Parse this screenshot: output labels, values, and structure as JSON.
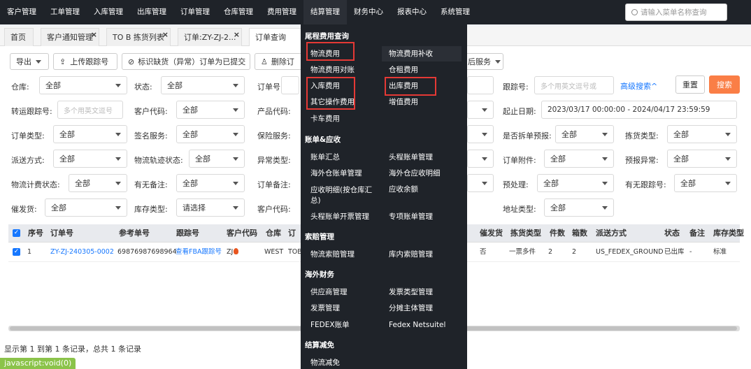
{
  "topnav": {
    "items": [
      "客户管理",
      "工单管理",
      "入库管理",
      "出库管理",
      "订单管理",
      "仓库管理",
      "费用管理",
      "结算管理",
      "财务中心",
      "报表中心",
      "系统管理"
    ],
    "search_placeholder": "请输入菜单名称查询"
  },
  "tabs": [
    "首页",
    "客户通知管理",
    "TO B 拣货列表",
    "订单:ZY-ZJ-2...",
    "订单查询"
  ],
  "toolbar": {
    "export": "导出",
    "upload_tracking": "上传跟踪号",
    "mark_abnormal": "标识缺货（异常）订单为已提交",
    "delete_prefix": "删除订",
    "after_sales": "后服务"
  },
  "filters": {
    "row1": {
      "warehouse_label": "仓库:",
      "warehouse_value": "全部",
      "status_label": "状态:",
      "status_value": "全部",
      "order_no_label": "订单号:",
      "tracking_label": "跟踪号:",
      "tracking_placeholder": "多个用英文逗号或",
      "advanced": "高级搜索^",
      "reset": "重置",
      "search": "搜索"
    },
    "row2": {
      "transfer_label": "转运跟踪号:",
      "transfer_placeholder": "多个用英文逗号",
      "customer_code_label": "客户代码:",
      "customer_code_value": "全部",
      "product_code_label": "产品代码:",
      "date_label": "起止日期:",
      "date_value": "2023/03/17 00:00:00 - 2024/04/17 23:59:59"
    },
    "row3": {
      "order_type_label": "订单类型:",
      "order_type_value": "全部",
      "sign_label": "签名服务:",
      "sign_value": "全部",
      "insure_label": "保险服务:",
      "split_label": "是否拆单预报:",
      "split_value": "全部",
      "pick_label": "拣货类型:",
      "pick_value": "全部"
    },
    "row4": {
      "dispatch_label": "派送方式:",
      "dispatch_value": "全部",
      "track_status_label": "物流轨迹状态:",
      "track_status_value": "全部",
      "abnormal_label": "异常类型:",
      "attach_label": "订单附件:",
      "attach_value": "全部",
      "forecast_label": "预报异常:",
      "forecast_value": "全部"
    },
    "row5": {
      "billing_label": "物流计费状态:",
      "billing_value": "全部",
      "remark_label": "有无备注:",
      "remark_value": "全部",
      "order_remark_label": "订单备注:",
      "preprocess_label": "预处理:",
      "preprocess_value": "全部",
      "notrack_label": "有无跟踪号:",
      "notrack_value": "全部"
    },
    "row6": {
      "urge_label": "催发货:",
      "urge_value": "全部",
      "stock_label": "库存类型:",
      "stock_value": "请选择",
      "cust_code_label": "客户代码:",
      "addr_label": "地址类型:",
      "addr_value": "全部"
    }
  },
  "table": {
    "headers": [
      "序号",
      "订单号",
      "参考单号",
      "跟踪号",
      "客户代码",
      "仓库",
      "订",
      "催发货",
      "拣货类型",
      "件数",
      "箱数",
      "派送方式",
      "状态",
      "备注",
      "库存类型"
    ],
    "row": {
      "seq": "1",
      "order_no": "ZY-ZJ-240305-0002",
      "ref_no": "69876987698964",
      "tracking": "查看FBA跟踪号",
      "customer": "ZJ",
      "warehouse": "WEST",
      "warehouse_cut": "TOB",
      "urge": "否",
      "pick_type": "一票多件",
      "pieces": "2",
      "boxes": "2",
      "dispatch": "US_FEDEX_GROUND",
      "status": "已出库",
      "remark": "-",
      "stock_type": "标准"
    }
  },
  "footer": {
    "records": "显示第 1 到第 1 条记录，总共 1 条记录",
    "status": "javascript:void(0)"
  },
  "dropdown": {
    "sec1": "尾程费用查询",
    "sec1_items": [
      "物流费用",
      "物流费用补收",
      "物流费用对账",
      "仓租费用",
      "入库费用",
      "出库费用",
      "其它操作费用",
      "增值费用",
      "卡车费用"
    ],
    "sec2": "账单&应收",
    "sec2_items": [
      "账单汇总",
      "头程账单管理",
      "海外仓账单管理",
      "海外仓应收明细",
      "应收明细(按仓库汇总)",
      "应收余额",
      "头程账单开票管理",
      "专项账单管理"
    ],
    "sec3": "索赔管理",
    "sec3_items": [
      "物流索赔管理",
      "库内索赔管理"
    ],
    "sec4": "海外财务",
    "sec4_items": [
      "供应商管理",
      "发票类型管理",
      "发票管理",
      "分摊主体管理",
      "FEDEX账单",
      "Fedex Netsuitel"
    ],
    "sec5": "结算减免",
    "sec5_items": [
      "物流减免"
    ]
  },
  "colors": {
    "nav_bg": "#1f2329",
    "accent_blue": "#1677ff",
    "search_orange": "#fa7e46",
    "highlight_red": "#e53935",
    "status_green": "#8bc34a"
  }
}
